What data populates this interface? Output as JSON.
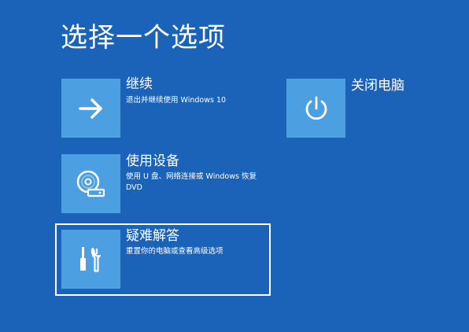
{
  "title": "选择一个选项",
  "options": [
    {
      "label": "继续",
      "description": "退出并继续使用 Windows 10",
      "icon": "arrow-right-icon"
    },
    {
      "label": "使用设备",
      "description": "使用 U 盘、网络连接或 Windows 恢复 DVD",
      "icon": "disc-drive-icon"
    },
    {
      "label": "疑难解答",
      "description": "重置你的电脑或查看高级选项",
      "icon": "tools-icon"
    },
    {
      "label": "关闭电脑",
      "description": "",
      "icon": "power-icon"
    }
  ],
  "colors": {
    "background": "#1b63b9",
    "tile": "#4c9fe0",
    "text": "#ffffff"
  }
}
